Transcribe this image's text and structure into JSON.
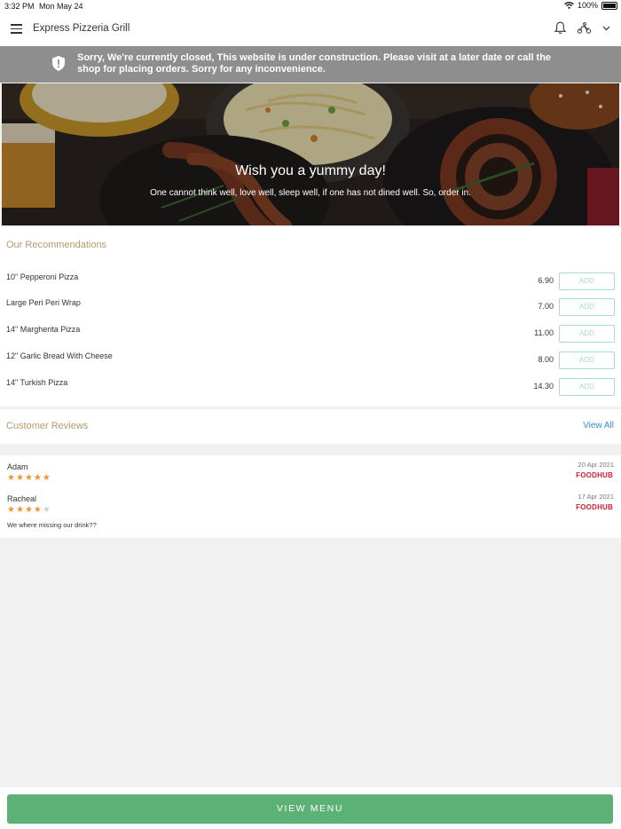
{
  "status_bar": {
    "time": "3:32 PM",
    "date": "Mon May 24",
    "battery": "100%"
  },
  "header": {
    "title": "Express Pizzeria Grill"
  },
  "banner": {
    "message": "Sorry, We're currently closed, This website is under construction. Please visit at a later date or call the shop for placing orders. Sorry for any inconvenience."
  },
  "hero": {
    "headline": "Wish you a yummy day!",
    "subline": "One cannot think well, love well, sleep well, if one has not dined well. So, order in."
  },
  "recommendations": {
    "title": "Our Recommendations",
    "add_label": "ADD",
    "items": [
      {
        "name": "10\" Pepperoni Pizza",
        "price": "6.90"
      },
      {
        "name": "Large Peri Peri Wrap",
        "price": "7.00"
      },
      {
        "name": "14\" Margherita Pizza",
        "price": "11.00"
      },
      {
        "name": "12\" Garlic Bread With Cheese",
        "price": "8.00"
      },
      {
        "name": "14\" Turkish Pizza",
        "price": "14.30"
      }
    ]
  },
  "reviews": {
    "title": "Customer Reviews",
    "view_all": "View All",
    "items": [
      {
        "name": "Adam",
        "date": "20 Apr 2021",
        "source": "FOODHUB",
        "rating": 5,
        "comment": ""
      },
      {
        "name": "Racheal",
        "date": "17 Apr 2021",
        "source": "FOODHUB",
        "rating": 4,
        "comment": "We where missing our drink??"
      }
    ]
  },
  "footer": {
    "button": "VIEW MENU"
  },
  "colors": {
    "accent": "#5cb276",
    "banner": "#8e8e8e",
    "section_title": "#b59a6c",
    "link": "#2f8fc1",
    "star": "#f0942e",
    "brand": "#d21f32"
  }
}
